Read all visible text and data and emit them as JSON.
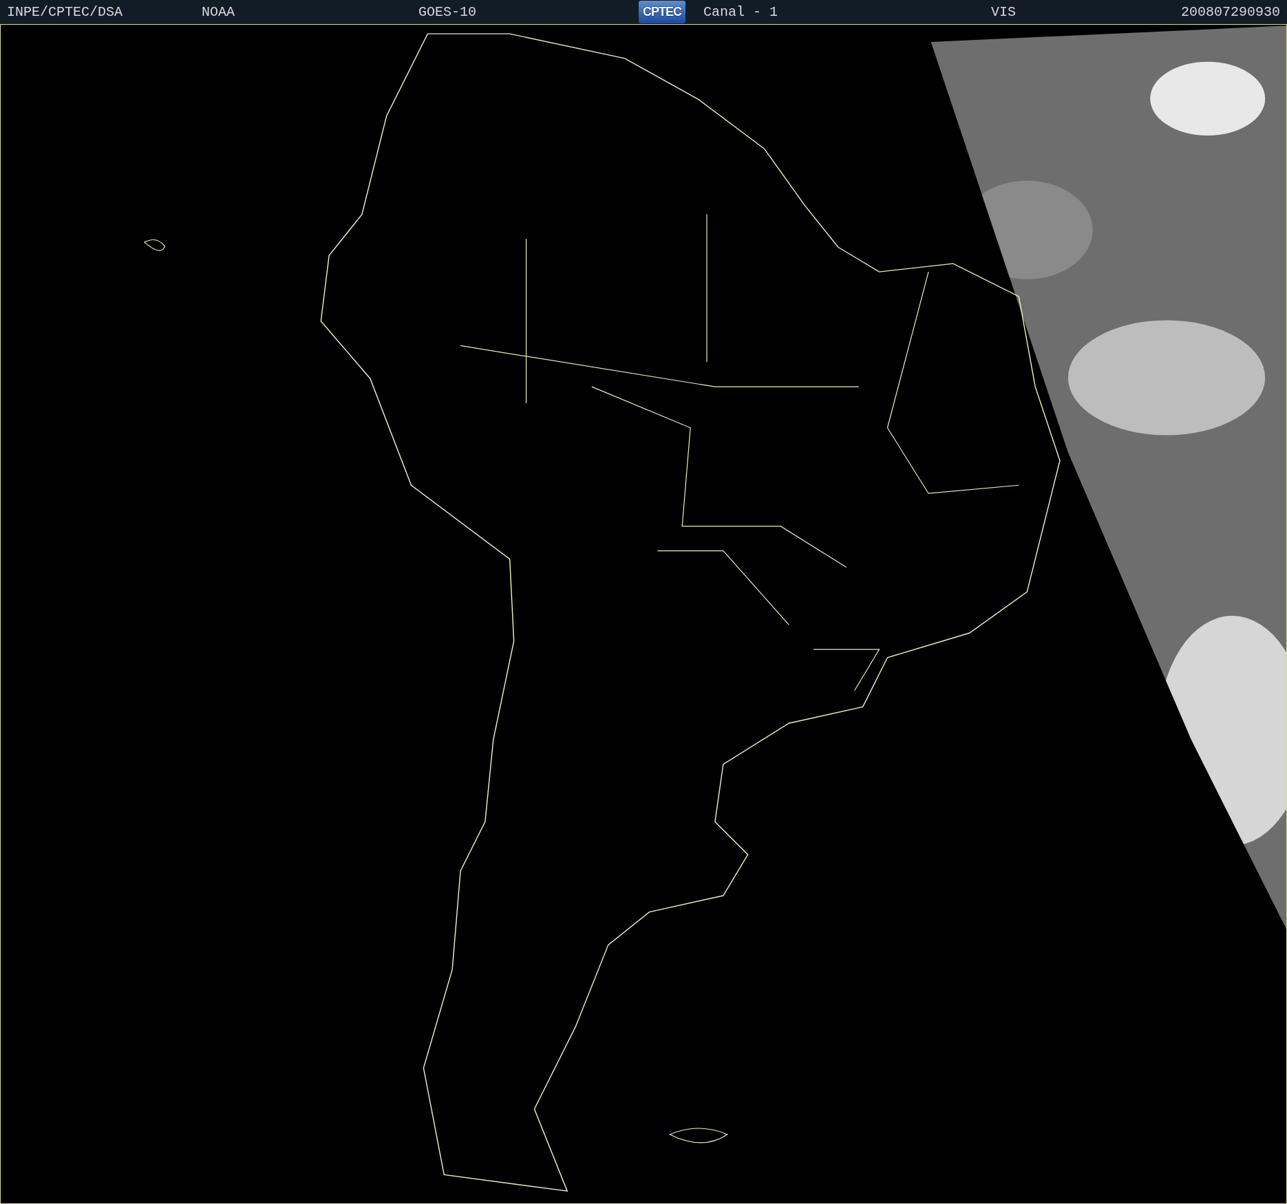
{
  "header": {
    "source": "INPE/CPTEC/DSA",
    "agency": "NOAA",
    "satellite": "GOES-10",
    "logo_text": "CPTEC",
    "channel": "Canal - 1",
    "band": "VIS",
    "timestamp": "200807290930"
  }
}
